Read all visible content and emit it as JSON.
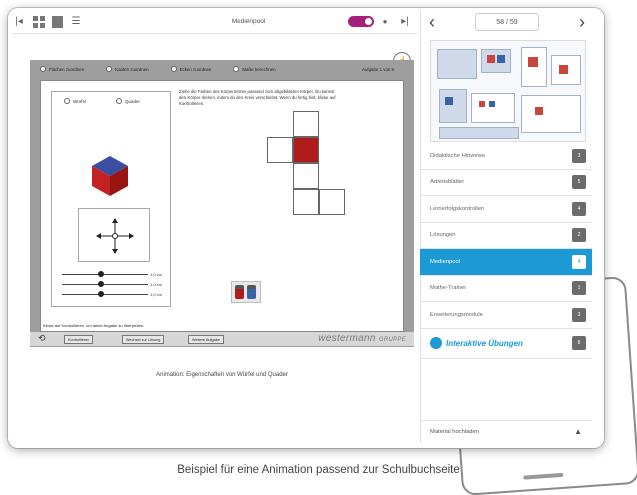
{
  "toolbar": {
    "title": "Medienpool",
    "page_counter": "58 / 59",
    "prev_label": "‹",
    "next_label": "›"
  },
  "menu": {
    "items": [
      {
        "label": "Didaktische Hinweise",
        "badge": "3"
      },
      {
        "label": "Arbeitsblätter",
        "badge": "5"
      },
      {
        "label": "Lernerfolgskontrollen",
        "badge": "4"
      },
      {
        "label": "Lösungen",
        "badge": "2"
      },
      {
        "label": "Medienpool",
        "badge": "4",
        "active": true
      },
      {
        "label": "Mathe-Trainer",
        "badge": "1"
      },
      {
        "label": "Erweiterungsmodule",
        "badge": "3"
      },
      {
        "label": "Interaktive Übungen",
        "badge": "8",
        "brand": true
      }
    ],
    "upload_label": "Material hochladen"
  },
  "animation": {
    "options": [
      "Flächen zuordnen",
      "Kanten zuordnen",
      "Ecken zuordnen",
      "Maße berechnen"
    ],
    "page_label": "Aufgabe  1 von 5",
    "shapes": [
      "Würfel",
      "Quader"
    ],
    "instructions": "Ziehe die Farben des Körpernetzes passend zum abgebildeten Körper. Du kannst den Körper drehen, indem du den Kreis verschiebst. Wenn du fertig bist, klicke auf Kontrollieren.",
    "slider_values": [
      "1,0 cm",
      "1,0 cm",
      "1,0 cm"
    ],
    "hint": "Klicke auf Kontrollieren, um deine Angabe zu überprüfen.",
    "buttons": [
      "Kontrollieren",
      "Wechsel zur Lösung",
      "Weitere Aufgabe"
    ],
    "brand": "westermann",
    "brand_suffix": "GRUPPE",
    "caption": "Animation: Eigenschaften von Würfel und Quader"
  },
  "caption": "Beispiel für eine Animation passend zur Schulbuchseite",
  "colors": {
    "accent": "#1b9ad6",
    "toggle": "#a51f7d",
    "net_face": "#b01b1b"
  }
}
